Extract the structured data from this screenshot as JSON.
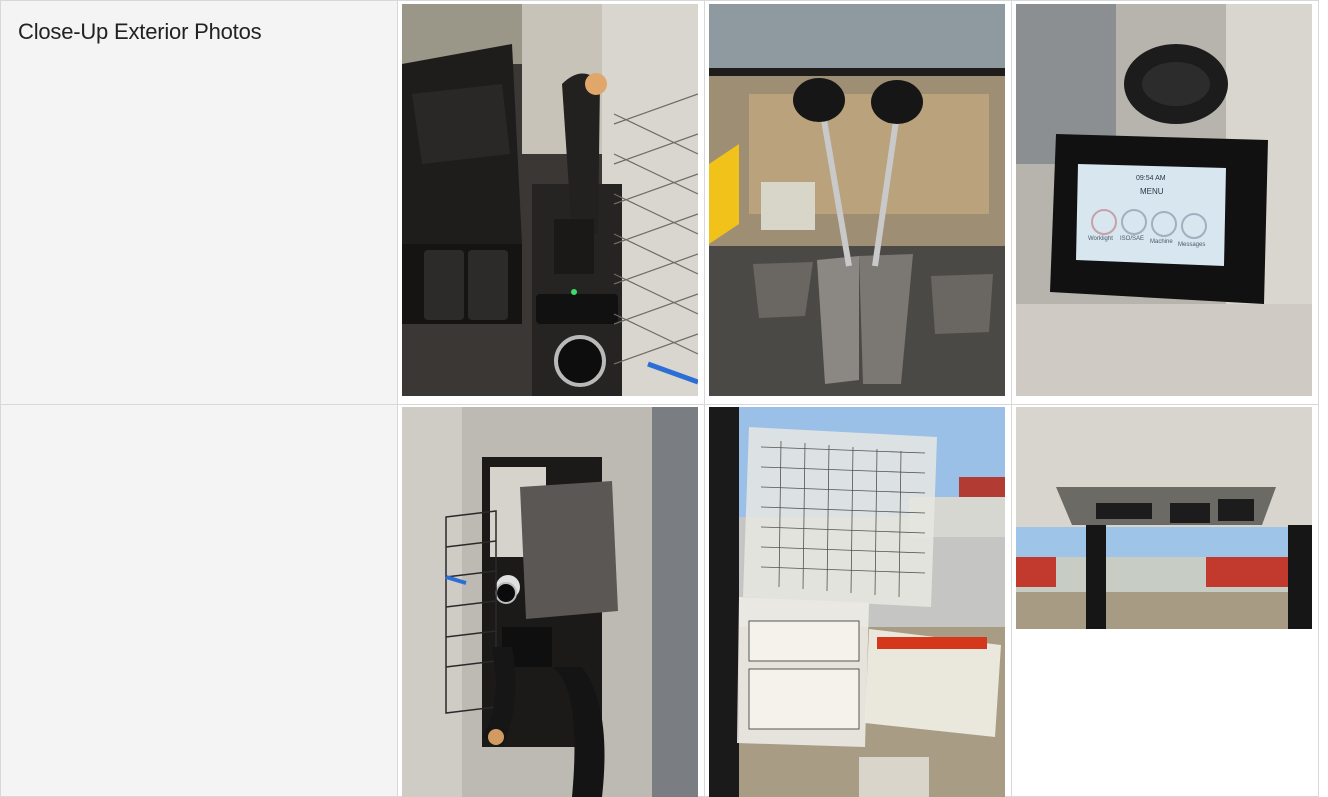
{
  "section": {
    "title": "Close-Up Exterior Photos"
  },
  "photos": [
    {
      "subject": "joystick with work-mode console"
    },
    {
      "subject": "travel levers and pedals"
    },
    {
      "subject": "in-cab display monitor",
      "screen_time": "09:54 AM",
      "screen_title": "MENU",
      "screen_items": [
        "Worklight",
        "ISO/SAE",
        "Machine",
        "Messages"
      ]
    },
    {
      "subject": "left console and joystick"
    },
    {
      "subject": "window load chart decals"
    },
    {
      "subject": "cab ceiling and rear view"
    }
  ],
  "colors": {
    "accent": "#2f86c9",
    "label_bg": "#f4f4f4",
    "border": "#d8d8d8"
  }
}
